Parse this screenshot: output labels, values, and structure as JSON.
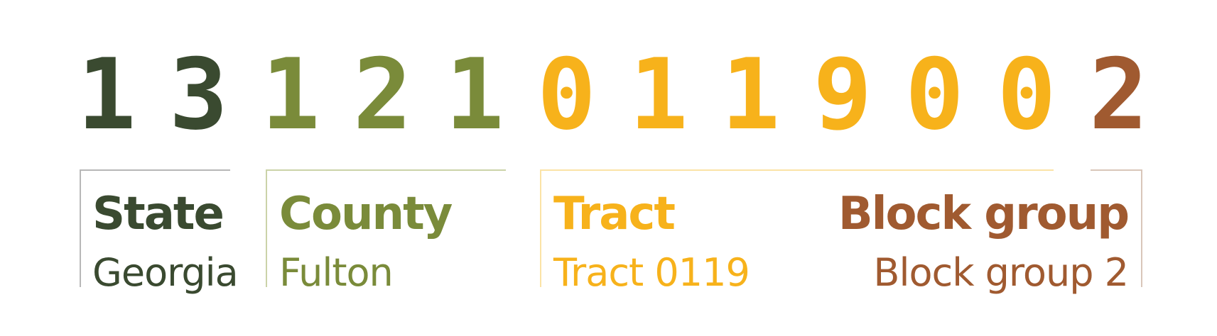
{
  "colors": {
    "state": "#3a4a30",
    "county": "#7a8b3a",
    "tract": "#f7b21b",
    "block_group": "#a05a30",
    "state_line": "#b7b7b7",
    "county_line": "#cbd3a8",
    "tract_line": "#fbe3a6",
    "block_group_line": "#d9c6b9"
  },
  "digits": [
    {
      "char": "1",
      "part": "state"
    },
    {
      "char": "3",
      "part": "state"
    },
    {
      "char": "1",
      "part": "county"
    },
    {
      "char": "2",
      "part": "county"
    },
    {
      "char": "1",
      "part": "county"
    },
    {
      "char": "0",
      "part": "tract"
    },
    {
      "char": "1",
      "part": "tract"
    },
    {
      "char": "1",
      "part": "tract"
    },
    {
      "char": "9",
      "part": "tract"
    },
    {
      "char": "0",
      "part": "tract"
    },
    {
      "char": "0",
      "part": "tract"
    },
    {
      "char": "2",
      "part": "block_group"
    }
  ],
  "segments": {
    "state": {
      "heading": "State",
      "value": "Georgia"
    },
    "county": {
      "heading": "County",
      "value": "Fulton"
    },
    "tract": {
      "heading": "Tract",
      "value": "Tract 0119"
    },
    "block_group": {
      "heading": "Block group",
      "value": "Block group 2"
    }
  }
}
